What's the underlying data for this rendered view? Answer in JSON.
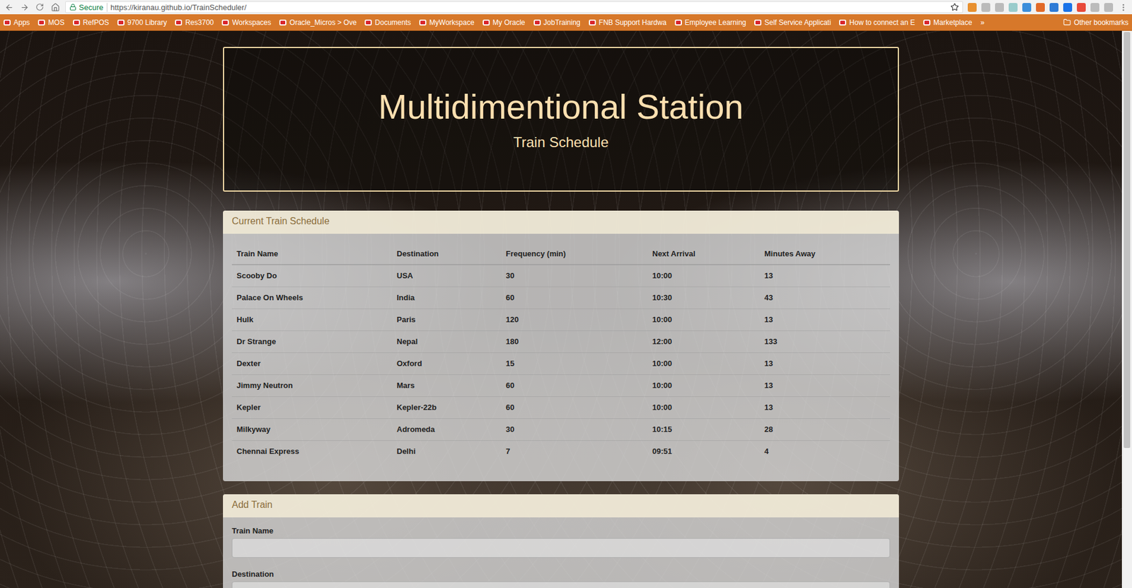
{
  "browser": {
    "security": "Secure",
    "url": "https://kiranau.github.io/TrainScheduler/",
    "bookmarks": [
      {
        "label": "Apps"
      },
      {
        "label": "MOS"
      },
      {
        "label": "RefPOS"
      },
      {
        "label": "9700 Library"
      },
      {
        "label": "Res3700"
      },
      {
        "label": "Workspaces"
      },
      {
        "label": "Oracle_Micros > Ove"
      },
      {
        "label": "Documents"
      },
      {
        "label": "MyWorkspace"
      },
      {
        "label": "My Oracle"
      },
      {
        "label": "JobTraining"
      },
      {
        "label": "FNB Support Hardwa"
      },
      {
        "label": "Employee Learning"
      },
      {
        "label": "Self Service Applicati"
      },
      {
        "label": "How to connect an E"
      },
      {
        "label": "Marketplace"
      }
    ],
    "overflow": "»",
    "other_bookmarks": "Other bookmarks"
  },
  "page": {
    "title": "Multidimentional Station",
    "subtitle": "Train Schedule",
    "schedule": {
      "heading": "Current Train Schedule",
      "columns": [
        "Train Name",
        "Destination",
        "Frequency (min)",
        "Next Arrival",
        "Minutes Away"
      ],
      "rows": [
        [
          "Scooby Do",
          "USA",
          "30",
          "10:00",
          "13"
        ],
        [
          "Palace On Wheels",
          "India",
          "60",
          "10:30",
          "43"
        ],
        [
          "Hulk",
          "Paris",
          "120",
          "10:00",
          "13"
        ],
        [
          "Dr Strange",
          "Nepal",
          "180",
          "12:00",
          "133"
        ],
        [
          "Dexter",
          "Oxford",
          "15",
          "10:00",
          "13"
        ],
        [
          "Jimmy Neutron",
          "Mars",
          "60",
          "10:00",
          "13"
        ],
        [
          "Kepler",
          "Kepler-22b",
          "60",
          "10:00",
          "13"
        ],
        [
          "Milkyway",
          "Adromeda",
          "30",
          "10:15",
          "28"
        ],
        [
          "Chennai Express",
          "Delhi",
          "7",
          "09:51",
          "4"
        ]
      ]
    },
    "add_train": {
      "heading": "Add Train",
      "fields": [
        {
          "label": "Train Name",
          "value": ""
        },
        {
          "label": "Destination",
          "value": ""
        }
      ]
    }
  },
  "scrollbar": {
    "level": 0.75
  }
}
